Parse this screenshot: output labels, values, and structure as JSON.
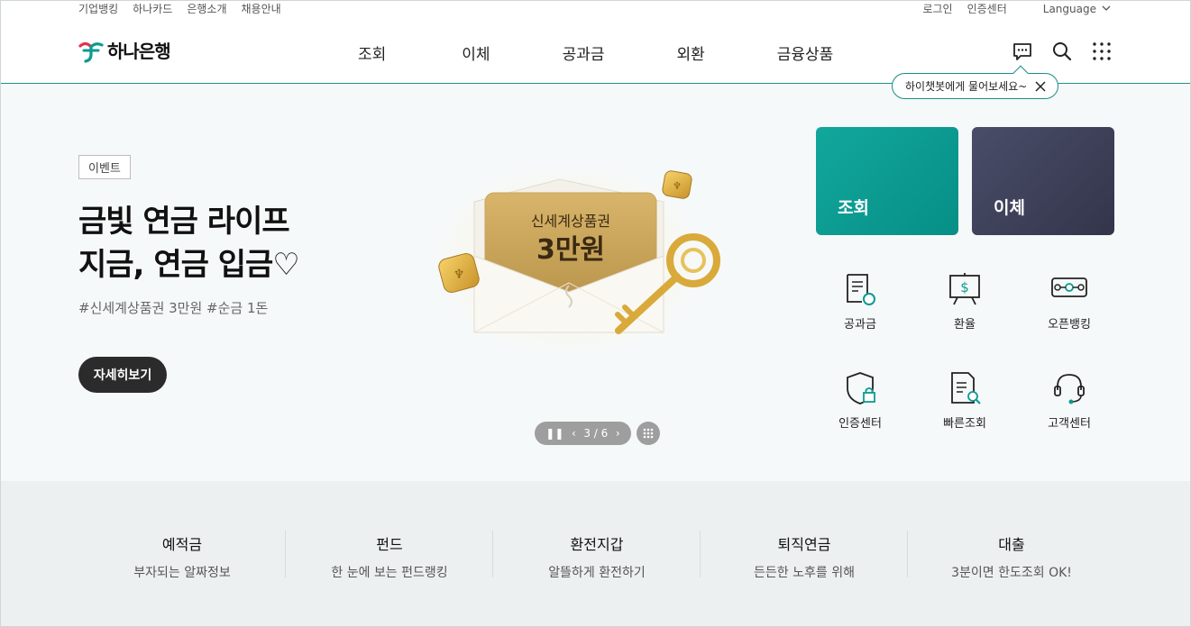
{
  "util": {
    "left_links": [
      "기업뱅킹",
      "하나카드",
      "은행소개",
      "채용안내"
    ],
    "login": "로그인",
    "cert_center": "인증센터",
    "language": "Language"
  },
  "header": {
    "logo_text": "하나은행",
    "nav": [
      "조회",
      "이체",
      "공과금",
      "외환",
      "금융상품"
    ],
    "chatbot_tooltip": "하이챗봇에게 물어보세요~"
  },
  "hero": {
    "badge": "이벤트",
    "headline_line1": "금빛 연금 라이프",
    "headline_line2": "지금, 연금 입금♡",
    "tags": "#신세계상품권 3만원 #순금 1돈",
    "more_button": "자세히보기",
    "visual_title": "신세계상품권",
    "visual_amount": "3만원",
    "pager": "3 / 6"
  },
  "tiles": {
    "inquiry": "조회",
    "transfer": "이체"
  },
  "quick_menu": [
    "공과금",
    "환율",
    "오픈뱅킹",
    "인증센터",
    "빠른조회",
    "고객센터"
  ],
  "bottom": [
    {
      "title": "예적금",
      "sub": "부자되는 알짜정보"
    },
    {
      "title": "펀드",
      "sub": "한 눈에 보는 펀드랭킹"
    },
    {
      "title": "환전지갑",
      "sub": "알뜰하게 환전하기"
    },
    {
      "title": "퇴직연금",
      "sub": "든든한 노후를 위해"
    },
    {
      "title": "대출",
      "sub": "3분이면 한도조회 OK!"
    }
  ],
  "colors": {
    "brand_teal": "#0c9a90",
    "dark_tile": "#3b3e56",
    "pager_grey": "#9e9e9e"
  }
}
